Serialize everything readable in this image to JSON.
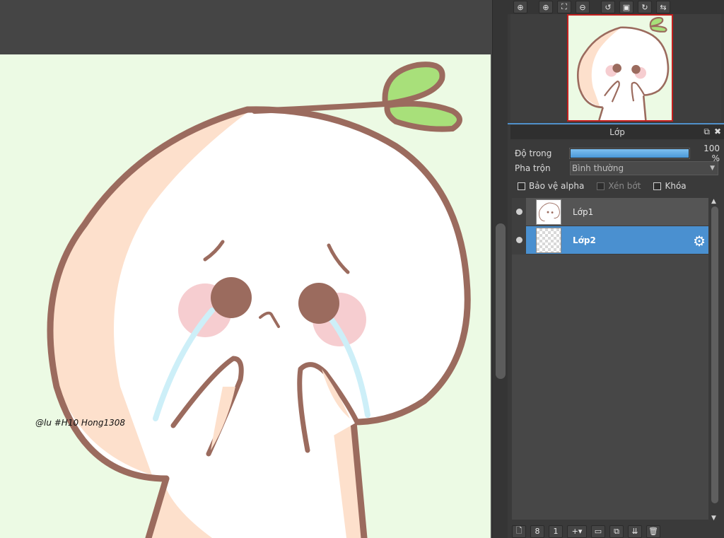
{
  "canvas": {
    "background_color": "#ecfae4",
    "signature_text": "@lu #H10 Hong1308"
  },
  "navigator_toolbar": {
    "buttons": [
      {
        "icon": "zoom-in-icon",
        "glyph": "⊕"
      },
      {
        "icon": "zoom-in-icon",
        "glyph": "⊕"
      },
      {
        "icon": "fit-screen-icon",
        "glyph": "⛶"
      },
      {
        "icon": "zoom-out-icon",
        "glyph": "⊖"
      },
      {
        "icon": "rotate-left-icon",
        "glyph": "↺"
      },
      {
        "icon": "fit-window-icon",
        "glyph": "▣"
      },
      {
        "icon": "rotate-right-icon",
        "glyph": "↻"
      },
      {
        "icon": "flip-horizontal-icon",
        "glyph": "⇆"
      }
    ]
  },
  "layer_panel": {
    "title": "Lớp",
    "opacity_label": "Độ trong",
    "opacity_value": "100 %",
    "opacity_percent": 100,
    "blend_label": "Pha trộn",
    "blend_value": "Bình thường",
    "checkboxes": {
      "protect_alpha": "Bảo vệ alpha",
      "clipping": "Xén bớt",
      "lock": "Khóa"
    },
    "layers": [
      {
        "name": "Lớp1",
        "visible": true,
        "selected": false
      },
      {
        "name": "Lớp2",
        "visible": true,
        "selected": true
      }
    ]
  },
  "layer_toolbar": {
    "buttons": [
      {
        "icon": "new-layer-icon",
        "glyph": "🗋"
      },
      {
        "icon": "new-8bit-layer-icon",
        "glyph": "8"
      },
      {
        "icon": "new-1bit-layer-icon",
        "glyph": "1"
      },
      {
        "icon": "add-layer-dropdown-icon",
        "glyph": "+▾"
      },
      {
        "icon": "new-folder-icon",
        "glyph": "▭"
      },
      {
        "icon": "duplicate-layer-icon",
        "glyph": "⧉"
      },
      {
        "icon": "merge-layer-icon",
        "glyph": "⇊"
      },
      {
        "icon": "delete-layer-icon",
        "glyph": "🗑"
      }
    ]
  },
  "colors": {
    "accent": "#4a90d0",
    "character_outline": "#9b6b5e",
    "cheek_blush": "#f6cdd0",
    "body_shade": "#fde0cc",
    "tears": "#cdeff8",
    "sprout": "#a8e07a"
  }
}
